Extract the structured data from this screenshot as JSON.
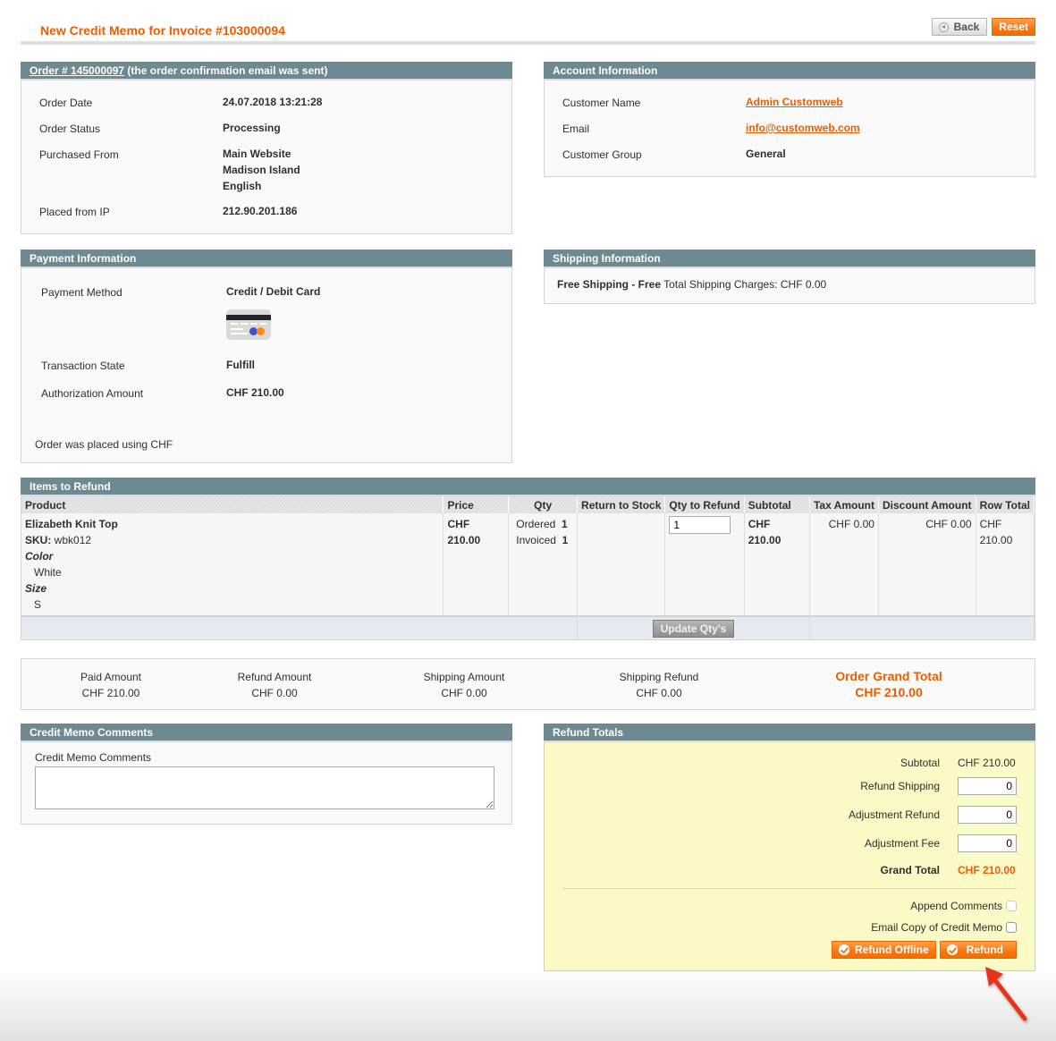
{
  "header": {
    "title": "New Credit Memo for Invoice #103000094",
    "back_label": "Back",
    "reset_label": "Reset"
  },
  "order_box": {
    "order_link": "Order # 145000097",
    "order_note": " (the order confirmation email was sent)",
    "rows": [
      {
        "label": "Order Date",
        "value": "24.07.2018 13:21:28"
      },
      {
        "label": "Order Status",
        "value": "Processing"
      },
      {
        "label": "Purchased From",
        "value_lines": [
          "Main Website",
          "Madison Island",
          "English"
        ]
      },
      {
        "label": "Placed from IP",
        "value": "212.90.201.186"
      }
    ]
  },
  "account_box": {
    "title": "Account Information",
    "rows": [
      {
        "label": "Customer Name",
        "value": "Admin Customweb"
      },
      {
        "label": "Email",
        "value": "info@customweb.com"
      },
      {
        "label": "Customer Group",
        "value": "General"
      }
    ]
  },
  "payment_box": {
    "title": "Payment Information",
    "rows": [
      {
        "label": "Payment Method",
        "value": "Credit / Debit Card"
      },
      {
        "label": "Transaction State",
        "value": "Fulfill"
      },
      {
        "label": "Authorization Amount",
        "value": "CHF 210.00"
      }
    ],
    "card_icon": "credit-card-icon",
    "footer_note": "Order was placed using CHF"
  },
  "shipping_box": {
    "title": "Shipping Information",
    "method": "Free Shipping - Free",
    "charges": " Total Shipping Charges: CHF 0.00"
  },
  "items": {
    "title": "Items to Refund",
    "columns": [
      "Product",
      "Price",
      "Qty",
      "Return to Stock",
      "Qty to Refund",
      "Subtotal",
      "Tax Amount",
      "Discount Amount",
      "Row Total"
    ],
    "rows": [
      {
        "product_name": "Elizabeth Knit Top",
        "sku_label": "SKU:",
        "sku": " wbk012",
        "options": [
          {
            "label": "Color",
            "value": "White"
          },
          {
            "label": "Size",
            "value": "S"
          }
        ],
        "price": "CHF 210.00",
        "qty_ordered_label": "Ordered",
        "qty_ordered": "1",
        "qty_invoiced_label": "Invoiced",
        "qty_invoiced": "1",
        "qty_to_refund": "1",
        "subtotal": "CHF 210.00",
        "tax": "CHF 0.00",
        "discount": "CHF 0.00",
        "row_total": "CHF 210.00"
      }
    ],
    "update_button": "Update Qty's"
  },
  "summary": {
    "paid_label": "Paid Amount",
    "paid_value": "CHF 210.00",
    "refund_label": "Refund Amount",
    "refund_value": "CHF 0.00",
    "shipping_label": "Shipping Amount",
    "shipping_value": "CHF 0.00",
    "shipping_refund_label": "Shipping Refund",
    "shipping_refund_value": "CHF 0.00",
    "grand_label": "Order Grand Total",
    "grand_value": "CHF 210.00"
  },
  "comments_box": {
    "title": "Credit Memo Comments",
    "field_label": "Credit Memo Comments",
    "value": ""
  },
  "refund_totals": {
    "title": "Refund Totals",
    "subtotal_label": "Subtotal",
    "subtotal_value": "CHF 210.00",
    "refund_shipping_label": "Refund Shipping",
    "refund_shipping_value": "0",
    "adjustment_refund_label": "Adjustment Refund",
    "adjustment_refund_value": "0",
    "adjustment_fee_label": "Adjustment Fee",
    "adjustment_fee_value": "0",
    "grand_total_label": "Grand Total",
    "grand_total_value": "CHF 210.00",
    "append_comments_label": "Append Comments",
    "append_comments_checked": false,
    "email_copy_label": "Email Copy of Credit Memo",
    "email_copy_checked": false,
    "refund_offline_label": "Refund Offline",
    "refund_label": "Refund"
  },
  "annotation": {
    "arrow_color": "#e8301c",
    "arrow_target": "refund-button"
  },
  "colors": {
    "accent": "#eb5e00",
    "box_header": "#6f8992",
    "refund_panel": "#fbf9c6"
  }
}
